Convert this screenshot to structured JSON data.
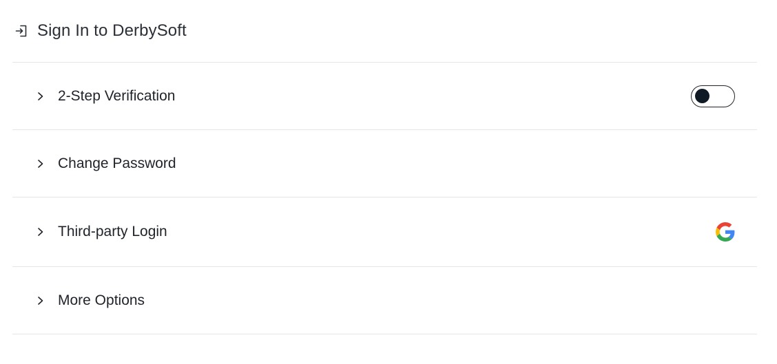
{
  "header": {
    "title": "Sign In to DerbySoft",
    "icon": "sign-in-icon"
  },
  "rows": [
    {
      "label": "2-Step Verification",
      "control": "toggle",
      "toggle_on": false
    },
    {
      "label": "Change Password"
    },
    {
      "label": "Third-party Login",
      "provider_icon": "google-icon"
    },
    {
      "label": "More Options"
    }
  ],
  "colors": {
    "text": "#1f2329",
    "divider": "#e6e6e6",
    "toggle_knob": "#0f1a24"
  }
}
